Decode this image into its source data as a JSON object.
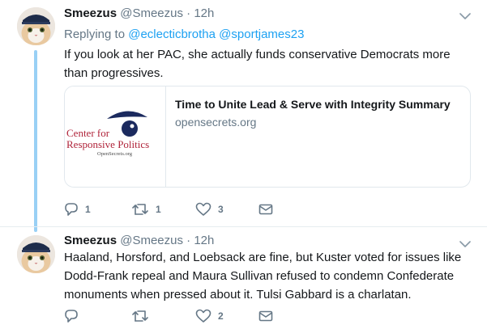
{
  "tweets": [
    {
      "name": "Smeezus",
      "handle": "@Smeezus",
      "separator": "·",
      "time": "12h",
      "replying_prefix": "Replying to",
      "replying_to": [
        "@eclecticbrotha",
        "@sportjames23"
      ],
      "text": "If you look at her PAC, she actually funds conservative Democrats more than progressives.",
      "card": {
        "title": "Time to Unite Lead & Serve with Integrity Summary",
        "domain": "opensecrets.org",
        "logo": {
          "line1": "Center for",
          "line2": "Responsive Politics",
          "line3": "OpenSecrets.org"
        }
      },
      "actions": {
        "reply_icon": "reply-icon",
        "reply_count": "1",
        "retweet_icon": "retweet-icon",
        "retweet_count": "1",
        "like_icon": "heart-icon",
        "like_count": "3",
        "dm_icon": "envelope-icon"
      }
    },
    {
      "name": "Smeezus",
      "handle": "@Smeezus",
      "separator": "·",
      "time": "12h",
      "text": "Haaland, Horsford, and Loebsack are fine, but Kuster voted for issues like Dodd-Frank repeal and Maura Sullivan refused to condemn Confederate monuments when pressed about it. Tulsi Gabbard is a charlatan.",
      "actions": {
        "reply_icon": "reply-icon",
        "reply_count": "",
        "retweet_icon": "retweet-icon",
        "retweet_count": "",
        "like_icon": "heart-icon",
        "like_count": "2",
        "dm_icon": "envelope-icon"
      }
    }
  ],
  "colors": {
    "link": "#1da1f2",
    "secondary_text": "#657786",
    "thread_line": "#99d0f5",
    "logo_red": "#b0243a",
    "logo_navy": "#1b2a5e"
  }
}
